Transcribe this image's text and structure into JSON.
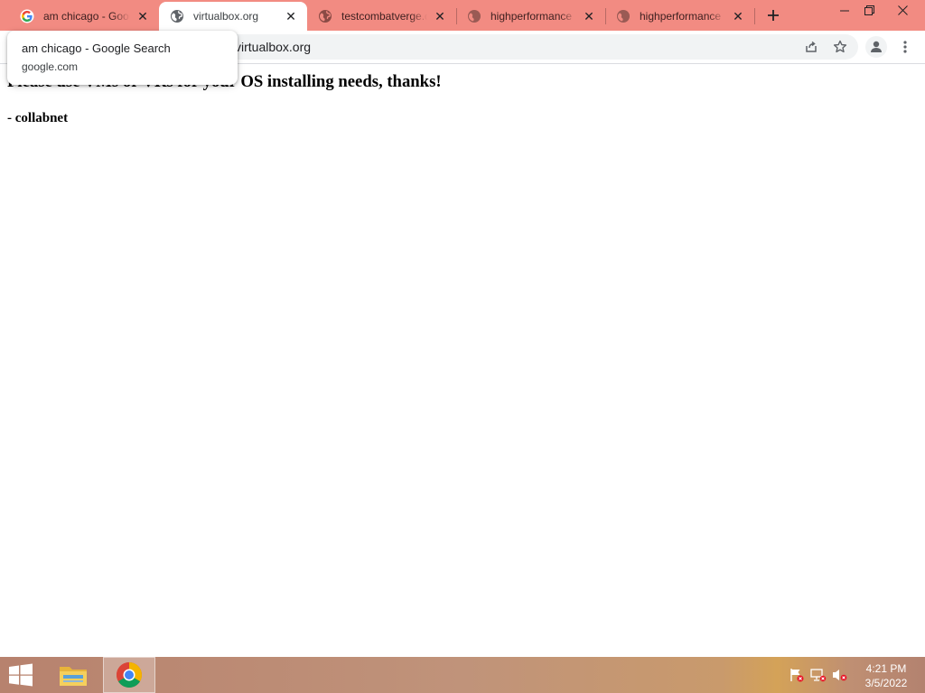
{
  "browser": {
    "tabs": [
      {
        "title": "am chicago - Google Search",
        "icon": "google-icon",
        "active": false
      },
      {
        "title": "virtualbox.org",
        "icon": "globe-icon",
        "active": true
      },
      {
        "title": "testcombatverge.com",
        "icon": "globe-icon",
        "active": false
      },
      {
        "title": "highperformance",
        "icon": "globe-icon",
        "active": false
      },
      {
        "title": "highperformance",
        "icon": "globe-icon",
        "active": false
      }
    ],
    "address": "virtualbox.org",
    "hover_card": {
      "title": "am chicago - Google Search",
      "domain": "google.com"
    }
  },
  "page": {
    "heading": "Please use VMs or VRs for your OS installing needs, thanks!",
    "signature": "- collabnet"
  },
  "taskbar": {
    "time": "4:21 PM",
    "date": "3/5/2022",
    "apps": [
      "file-explorer-icon",
      "chrome-icon"
    ],
    "tray": [
      "action-center-flag-icon",
      "network-icon",
      "volume-muted-icon"
    ]
  },
  "colors": {
    "tabstrip": "#f28b82",
    "accent": "#1a73e8"
  }
}
